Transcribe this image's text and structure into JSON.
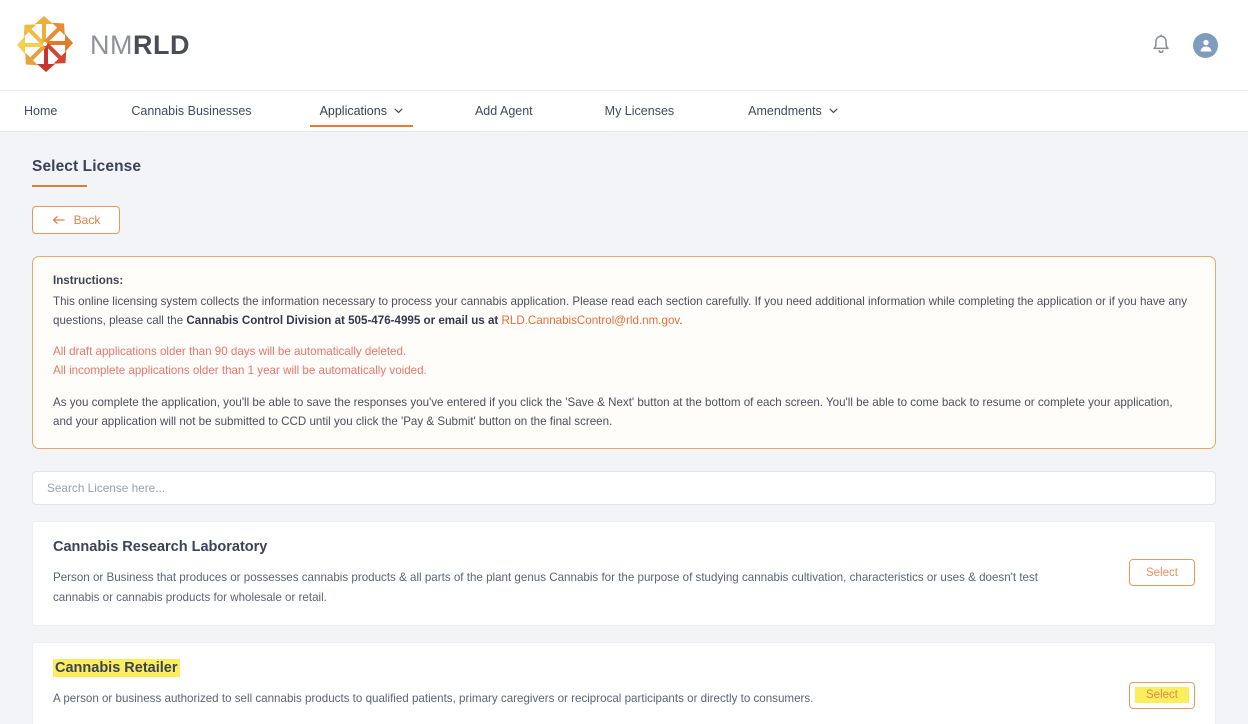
{
  "header": {
    "brand_nm": "NM",
    "brand_rld": "RLD",
    "notifications_icon": "bell-icon",
    "account_icon": "user-avatar-icon"
  },
  "nav": {
    "items": [
      {
        "label": "Home",
        "has_caret": false,
        "active": false
      },
      {
        "label": "Cannabis Businesses",
        "has_caret": false,
        "active": false
      },
      {
        "label": "Applications",
        "has_caret": true,
        "active": true
      },
      {
        "label": "Add Agent",
        "has_caret": false,
        "active": false
      },
      {
        "label": "My Licenses",
        "has_caret": false,
        "active": false
      },
      {
        "label": "Amendments",
        "has_caret": true,
        "active": false
      }
    ]
  },
  "page": {
    "title": "Select License",
    "back_label": "Back"
  },
  "instructions": {
    "heading": "Instructions:",
    "p1_part1": "This online licensing system collects the information necessary to process your cannabis application. Please read each section carefully. If you need additional information while completing the application or if you have any questions, please call the ",
    "p1_bold": "Cannabis Control Division at 505-476-4995 or email us at",
    "p1_space": " ",
    "email": "RLD.CannabisControl@rld.nm.gov",
    "p1_end": ".",
    "warning_1": "All draft applications older than 90 days will be automatically deleted.",
    "warning_2": "All incomplete applications older than 1 year will be automatically voided.",
    "p2": "As you complete the application, you'll be able to save the responses you've entered if you click the 'Save & Next' button at the bottom of each screen. You'll be able to come back to resume or complete your application, and your application will not be submitted to CCD until you click the 'Pay & Submit' button on the final screen."
  },
  "search": {
    "placeholder": "Search License here...",
    "value": ""
  },
  "licenses": [
    {
      "name": "Cannabis Research Laboratory",
      "description": "Person or Business that produces or possesses cannabis products & all parts of the plant genus Cannabis for the purpose of studying cannabis cultivation, characteristics or uses & doesn't test cannabis or cannabis products for wholesale or retail.",
      "select_label": "Select",
      "name_highlighted": false,
      "select_highlighted": false
    },
    {
      "name": "Cannabis Retailer",
      "description": "A person or business authorized to sell cannabis products to qualified patients, primary caregivers or reciprocal participants or directly to consumers.",
      "select_label": "Select",
      "name_highlighted": true,
      "select_highlighted": true
    }
  ],
  "colors": {
    "accent_orange": "#e07b39",
    "warning_red": "#e8756b",
    "highlight_yellow": "#fbee5d",
    "page_bg": "#f2f4f8"
  }
}
